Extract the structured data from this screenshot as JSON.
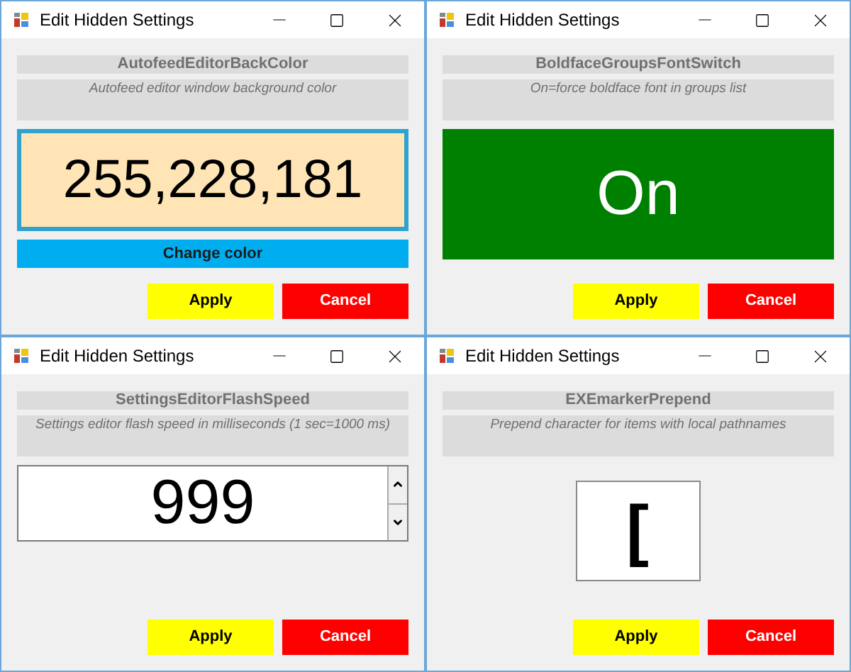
{
  "windows": [
    {
      "kind": "color",
      "title": "Edit Hidden Settings",
      "setting_name": "AutofeedEditorBackColor",
      "description": "Autofeed editor window background color",
      "value": "255,228,181",
      "color": "#ffe4b5",
      "action": "Change color",
      "buttons": [
        "Apply",
        "Cancel"
      ]
    },
    {
      "kind": "switch",
      "title": "Edit Hidden Settings",
      "setting_name": "BoldfaceGroupsFontSwitch",
      "description": "On=force boldface font in groups list",
      "value": "On",
      "on": true,
      "buttons": [
        "Apply",
        "Cancel"
      ]
    },
    {
      "kind": "number",
      "title": "Edit Hidden Settings",
      "setting_name": "SettingsEditorFlashSpeed",
      "description": "Settings editor flash speed in milliseconds (1 sec=1000 ms)",
      "value": "999",
      "buttons": [
        "Apply",
        "Cancel"
      ]
    },
    {
      "kind": "char",
      "title": "Edit Hidden Settings",
      "setting_name": "EXEmarkerPrepend",
      "description": "Prepend character for items with local pathnames",
      "value": "[",
      "buttons": [
        "Apply",
        "Cancel"
      ]
    }
  ]
}
